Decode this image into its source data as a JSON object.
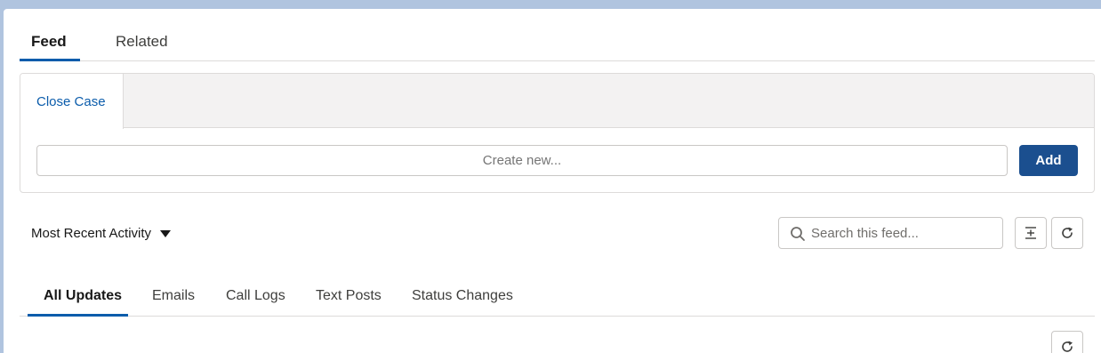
{
  "tabs": {
    "feed": "Feed",
    "related": "Related"
  },
  "publisher": {
    "action_tab": "Close Case",
    "create_placeholder": "Create new...",
    "add_label": "Add"
  },
  "feed_controls": {
    "sort_label": "Most Recent Activity",
    "search_placeholder": "Search this feed...",
    "collapse_icon": "collapse-expand-icon",
    "refresh_icon": "refresh-icon"
  },
  "feed_filters": [
    "All Updates",
    "Emails",
    "Call Logs",
    "Text Posts",
    "Status Changes"
  ],
  "colors": {
    "accent": "#0b5cab",
    "button": "#1b4f8f",
    "background": "#b0c4df"
  }
}
